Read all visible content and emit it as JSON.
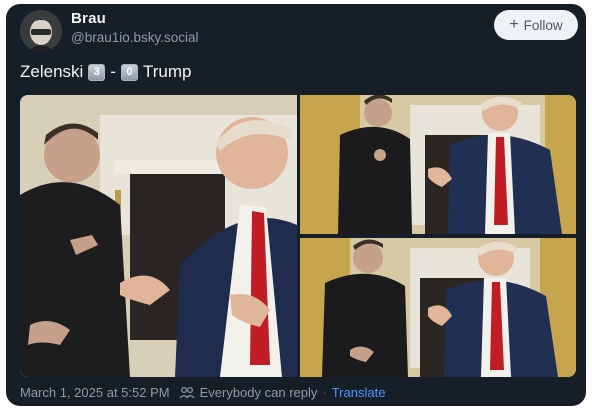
{
  "post": {
    "author": {
      "display_name": "Brau",
      "handle": "@brau1io.bsky.social",
      "avatar_icon": "avatar-photo"
    },
    "follow": {
      "label": "Follow",
      "icon": "plus-icon"
    },
    "text": {
      "part1": "Zelenski",
      "score1": "3",
      "dash": "-",
      "score2": "0",
      "part2": "Trump"
    },
    "media": {
      "count": 3
    },
    "footer": {
      "timestamp": "March 1, 2025 at 5:52 PM",
      "reply_icon": "people-icon",
      "reply_setting": "Everybody can reply",
      "separator": "·",
      "translate": "Translate"
    }
  },
  "colors": {
    "card_bg": "#161e27",
    "text_primary": "#f1f3f5",
    "text_secondary": "#8e9aa8",
    "link": "#4a96ff",
    "follow_bg": "#eef2f6"
  }
}
